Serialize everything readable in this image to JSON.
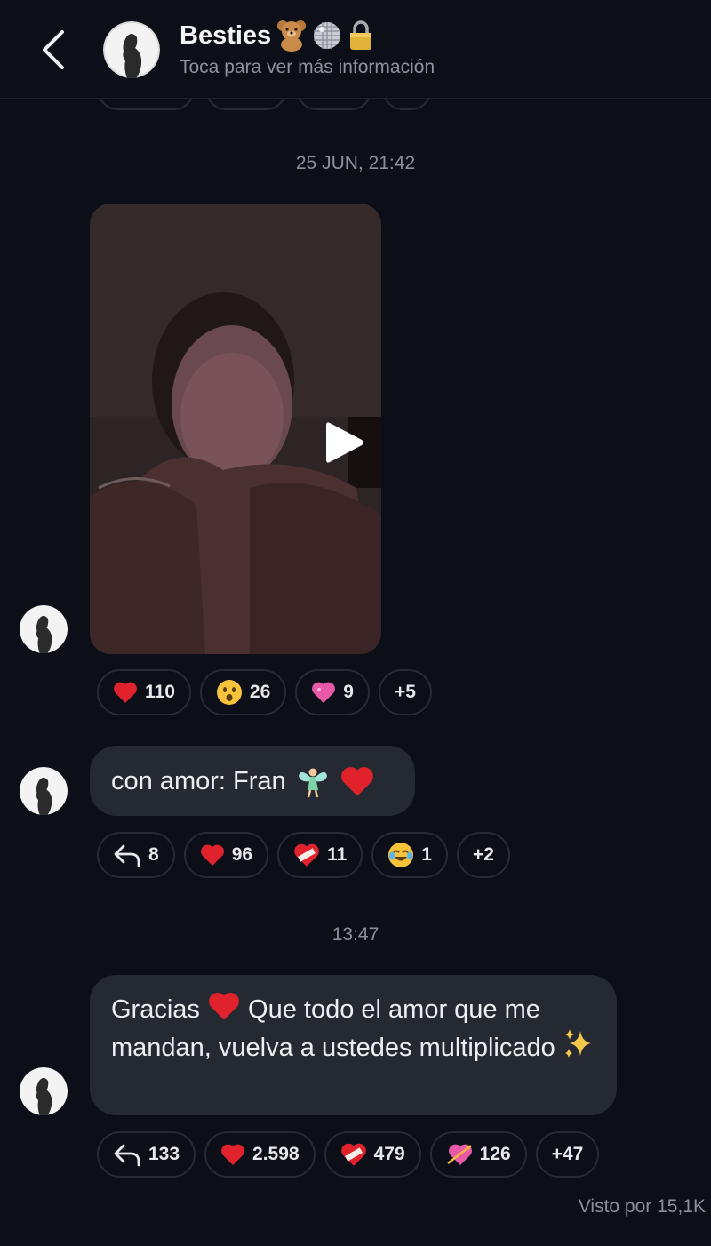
{
  "header": {
    "title": "Besties",
    "title_emojis": [
      "teddy-bear-icon",
      "disco-ball-icon",
      "lock-icon"
    ],
    "subtitle": "Toca para ver más información"
  },
  "messages": [
    {
      "timestamp": "25 JUN, 21:42",
      "type": "video",
      "reactions": [
        {
          "icon": "red-heart-icon",
          "count": "110"
        },
        {
          "icon": "surprised-face-icon",
          "count": "26"
        },
        {
          "icon": "pink-heart-icon",
          "count": "9"
        },
        {
          "icon": "",
          "count": "+5"
        }
      ]
    },
    {
      "type": "text",
      "text": "con amor: Fran",
      "emojis": [
        "fairy-icon",
        "red-heart-icon"
      ],
      "reactions": [
        {
          "icon": "reply-icon",
          "count": "8"
        },
        {
          "icon": "red-heart-icon",
          "count": "96"
        },
        {
          "icon": "heart-bandage-icon",
          "count": "11"
        },
        {
          "icon": "laughing-face-icon",
          "count": "1"
        },
        {
          "icon": "",
          "count": "+2"
        }
      ]
    },
    {
      "timestamp": "13:47",
      "type": "text",
      "text_part1": "Gracias",
      "text_part2": "Que todo el amor que me mandan, vuelva a ustedes multiplicado",
      "emojis": [
        "red-heart-icon",
        "sparkles-icon"
      ],
      "reactions": [
        {
          "icon": "reply-icon",
          "count": "133"
        },
        {
          "icon": "red-heart-icon",
          "count": "2.598"
        },
        {
          "icon": "heart-bandage-icon",
          "count": "479"
        },
        {
          "icon": "heart-arrow-icon",
          "count": "126"
        },
        {
          "icon": "",
          "count": "+47"
        }
      ]
    }
  ],
  "seen_by": "Visto por 15,1K",
  "colors": {
    "background": "#0c0f17",
    "bubble": "#252932",
    "chip_border": "#272b35",
    "heart_red": "#e0222c",
    "secondary_text": "#8b909b"
  }
}
